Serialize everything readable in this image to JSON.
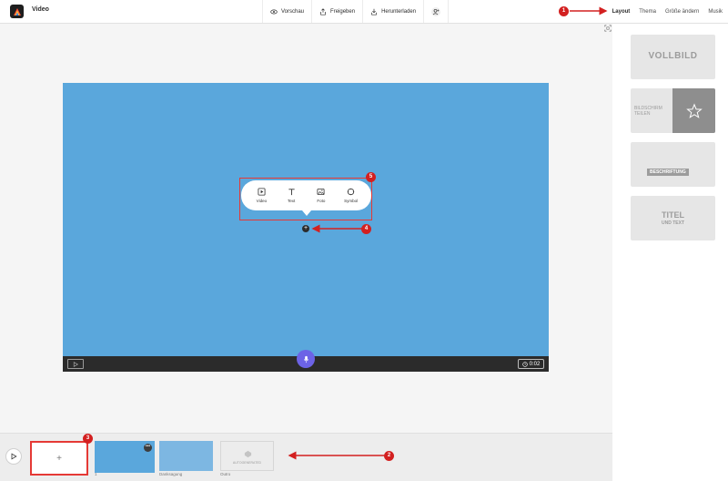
{
  "header": {
    "app_title": "Video",
    "actions": [
      {
        "label": "Vorschau",
        "icon": "eye-icon"
      },
      {
        "label": "Freigeben",
        "icon": "share-icon"
      },
      {
        "label": "Herunterladen",
        "icon": "download-icon"
      }
    ],
    "menu": [
      "Layout",
      "Thema",
      "Größe ändern",
      "Musik"
    ],
    "active_menu": "Layout"
  },
  "canvas": {
    "background": "#5aa7dc",
    "popup_items": [
      {
        "label": "Video",
        "icon": "video-icon"
      },
      {
        "label": "Text",
        "icon": "text-icon"
      },
      {
        "label": "Foto",
        "icon": "photo-icon"
      },
      {
        "label": "Symbol",
        "icon": "symbol-icon"
      }
    ],
    "timer": "0:02"
  },
  "layouts": {
    "vollbild": "VOLLBILD",
    "split_line1": "BILDSCHIRM",
    "split_line2": "TEILEN",
    "caption": "BESCHRIFTUNG",
    "title": "TITEL",
    "title_sub": "UND TEXT"
  },
  "timeline": {
    "add_symbol": "+",
    "slide_number": "1",
    "slides": [
      "Danksagung",
      "Outro"
    ],
    "outro_badge": "AUTOGENERATED"
  },
  "annotations": [
    "1",
    "2",
    "3",
    "4",
    "5"
  ],
  "colors": {
    "accent": "#6c63e6",
    "marker": "#d32020"
  }
}
